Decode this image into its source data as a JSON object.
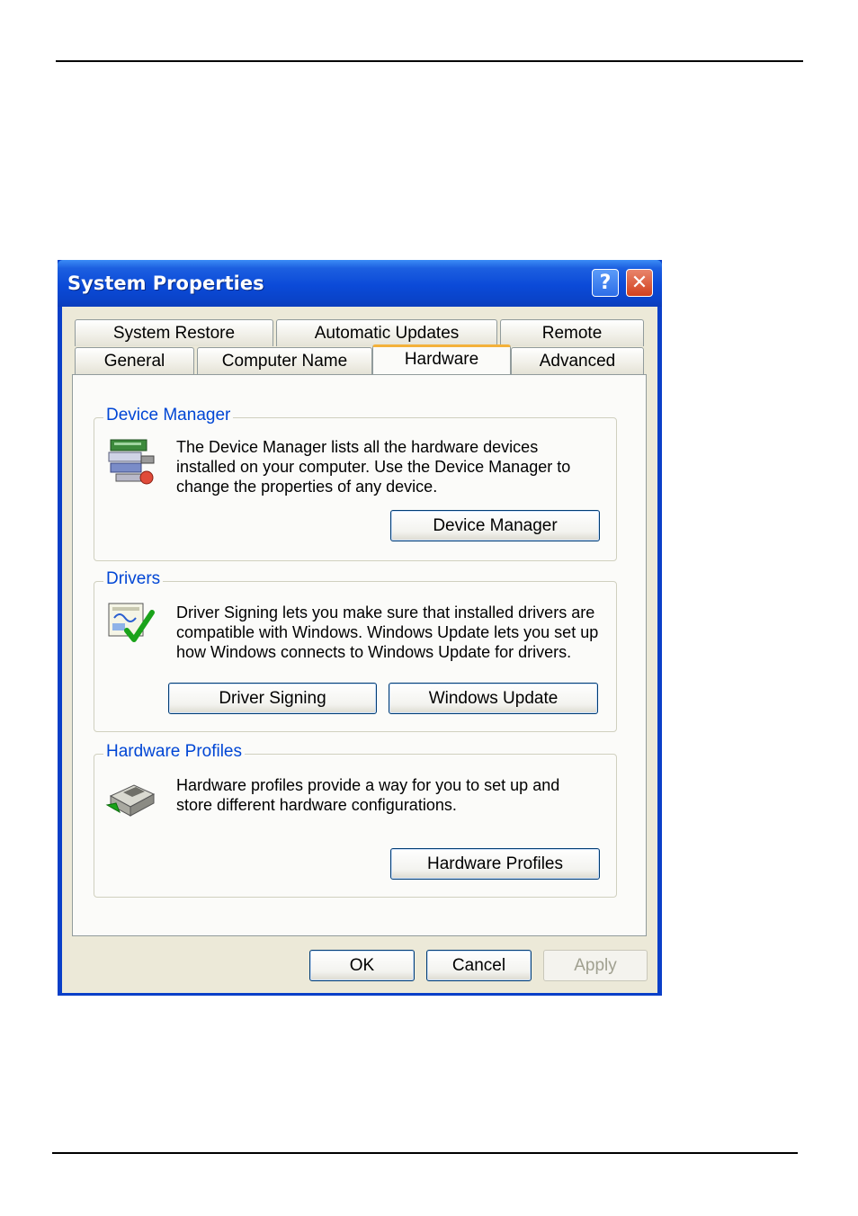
{
  "window": {
    "title": "System Properties",
    "help_glyph": "?",
    "close_glyph": "✕"
  },
  "tabs": {
    "row_back": [
      {
        "label": "System Restore"
      },
      {
        "label": "Automatic Updates"
      },
      {
        "label": "Remote"
      }
    ],
    "row_front": [
      {
        "label": "General"
      },
      {
        "label": "Computer Name"
      },
      {
        "label": "Hardware",
        "active": true
      },
      {
        "label": "Advanced"
      }
    ]
  },
  "device_manager": {
    "legend": "Device Manager",
    "icon": "device-manager-icon",
    "description": "The Device Manager lists all the hardware devices installed on your computer. Use the Device Manager to change the properties of any device.",
    "button": "Device Manager"
  },
  "drivers": {
    "legend": "Drivers",
    "icon": "driver-signing-icon",
    "description": "Driver Signing lets you make sure that installed drivers are compatible with Windows. Windows Update lets you set up how Windows connects to Windows Update for drivers.",
    "button_signing": "Driver Signing",
    "button_update": "Windows Update"
  },
  "hardware_profiles": {
    "legend": "Hardware Profiles",
    "icon": "hardware-profiles-icon",
    "description": "Hardware profiles provide a way for you to set up and store different hardware configurations.",
    "button": "Hardware Profiles"
  },
  "footer": {
    "ok": "OK",
    "cancel": "Cancel",
    "apply": "Apply"
  },
  "colors": {
    "titlebar": "#0a4ad8",
    "legend_text": "#0046d5",
    "active_tab_accent": "#f3b13a",
    "dialog_face": "#ece9d8"
  }
}
